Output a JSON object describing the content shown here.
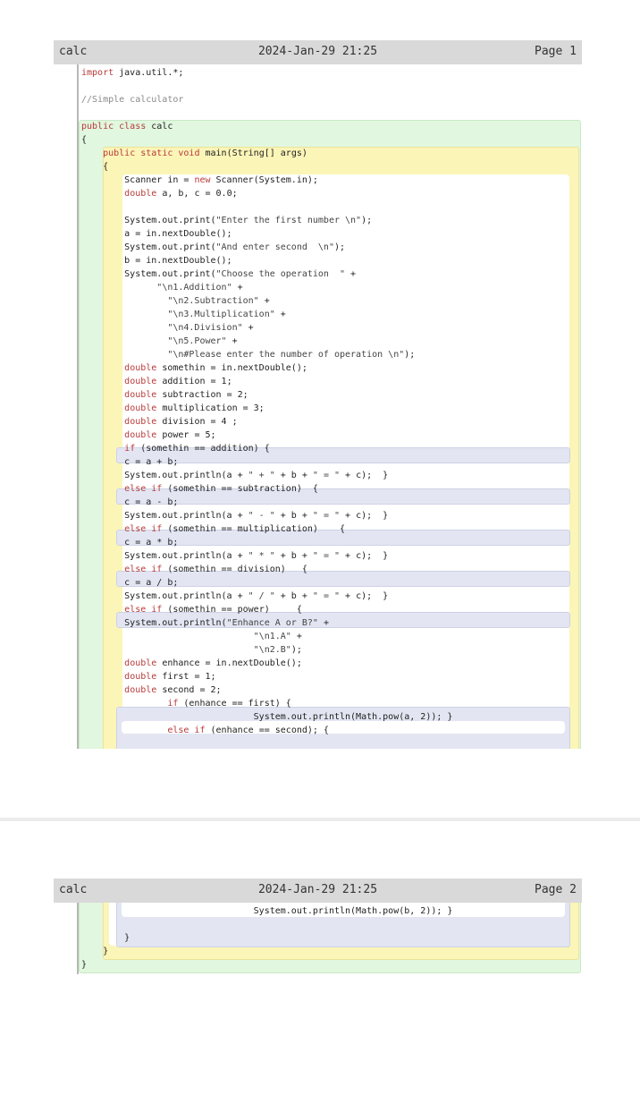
{
  "pages": [
    {
      "header": {
        "file": "calc",
        "date": "2024-Jan-29 21:25",
        "page": "Page 1"
      },
      "lines": [
        "<span class=\"kw\">import</span> java.util.*;",
        "",
        "<span class=\"cm\">//Simple calculator</span>",
        "",
        "<span class=\"kw\">public class</span> calc",
        "{",
        "    <span class=\"kw\">public static void</span> main(String[] args)",
        "    {",
        "        Scanner in = <span class=\"kw\">new</span> Scanner(System.in);",
        "        <span class=\"kw\">double</span> a, b, c = 0.0;",
        "",
        "        System.out.print(<span class=\"str\">\"Enter the first number \\n\"</span>);",
        "        a = in.nextDouble();",
        "        System.out.print(<span class=\"str\">\"And enter second  \\n\"</span>);",
        "        b = in.nextDouble();",
        "        System.out.print(<span class=\"str\">\"Choose the operation  \"</span> +",
        "              <span class=\"str\">\"\\n1.Addition\"</span> +",
        "                <span class=\"str\">\"\\n2.Subtraction\"</span> +",
        "                <span class=\"str\">\"\\n3.Multiplication\"</span> +",
        "                <span class=\"str\">\"\\n4.Division\"</span> +",
        "                <span class=\"str\">\"\\n5.Power\"</span> +",
        "                <span class=\"str\">\"\\n#Please enter the number of operation \\n\"</span>);",
        "        <span class=\"kw\">double</span> somethin = in.nextDouble();",
        "        <span class=\"kw\">double</span> addition = 1;",
        "        <span class=\"kw\">double</span> subtraction = 2;",
        "        <span class=\"kw\">double</span> multiplication = 3;",
        "        <span class=\"kw\">double</span> division = 4 ;",
        "        <span class=\"kw\">double</span> power = 5;",
        "        <span class=\"kw\">if</span> (somethin == addition) {",
        "        c = a + b;",
        "        System.out.println(a + <span class=\"str\">\" + \"</span> + b + <span class=\"str\">\" = \"</span> + c);  }",
        "        <span class=\"kw\">else if</span> (somethin == subtraction)  {",
        "        c = a - b;",
        "        System.out.println(a + <span class=\"str\">\" - \"</span> + b + <span class=\"str\">\" = \"</span> + c);  }",
        "        <span class=\"kw\">else if</span> (somethin == multiplication)    {",
        "        c = a * b;",
        "        System.out.println(a + <span class=\"str\">\" * \"</span> + b + <span class=\"str\">\" = \"</span> + c);  }",
        "        <span class=\"kw\">else if</span> (somethin == division)   {",
        "        c = a / b;",
        "        System.out.println(a + <span class=\"str\">\" / \"</span> + b + <span class=\"str\">\" = \"</span> + c);  }",
        "        <span class=\"kw\">else if</span> (somethin == power)     {",
        "        System.out.println(<span class=\"str\">\"Enhance A or B?\"</span> +",
        "                                <span class=\"str\">\"\\n1.A\"</span> +",
        "                                <span class=\"str\">\"\\n2.B\"</span>);",
        "        <span class=\"kw\">double</span> enhance = in.nextDouble();",
        "        <span class=\"kw\">double</span> first = 1;",
        "        <span class=\"kw\">double</span> second = 2;",
        "                <span class=\"kw\">if</span> (enhance == first) {",
        "                                System.out.println(Math.pow(a, 2)); }",
        "                <span class=\"kw\">else if</span> (enhance == second); {"
      ]
    },
    {
      "header": {
        "file": "calc",
        "date": "2024-Jan-29 21:25",
        "page": "Page 2"
      },
      "lines": [
        "                                System.out.println(Math.pow(b, 2)); }",
        "",
        "        }",
        "    }",
        "}"
      ]
    }
  ]
}
